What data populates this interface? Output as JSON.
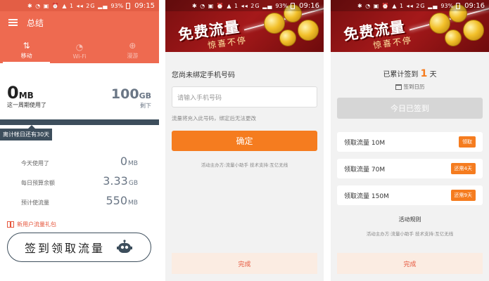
{
  "status": {
    "time": "09:15",
    "time2": "09:16",
    "battery": "93%",
    "icons": "✱ ◔ ▣ ⏰ ▲ 1 ◂◂ 2G ▂▄"
  },
  "screen1": {
    "title": "总结",
    "tabs": [
      {
        "label": "移动",
        "icon": "⇅"
      },
      {
        "label": "Wi-Fi",
        "icon": "◔"
      },
      {
        "label": "漫游",
        "icon": "⊕"
      }
    ],
    "used": {
      "value": "0",
      "unit": "MB",
      "label": "这一周期使用了"
    },
    "remaining": {
      "value": "100",
      "unit": "GB",
      "label": "剩下"
    },
    "progress_used_fraction": 0.0,
    "cycle_tip": "离计帐日还有30天",
    "stats": [
      {
        "label": "今天使用了",
        "value": "0",
        "unit": "MB"
      },
      {
        "label": "每日预算余额",
        "value": "3.33",
        "unit": "GB"
      },
      {
        "label": "预计使流量",
        "value": "550",
        "unit": "MB"
      }
    ],
    "gift_label": "新用户流量礼包",
    "checkin_label": "签到领取流量"
  },
  "banner": {
    "title": "免费流量",
    "subtitle": "惊喜不停"
  },
  "screen2": {
    "heading": "您尚未绑定手机号码",
    "phone_placeholder": "请输入手机号码",
    "hint": "流量将充入此号码，绑定后无法更改",
    "confirm_label": "确定",
    "credits": "活动主办方:流量小助手   技术支持:互亿无线",
    "done_label": "完成"
  },
  "screen3": {
    "signed_prefix": "已累计签到",
    "signed_days": "1",
    "signed_suffix": "天",
    "calendar_label": "签到日历",
    "signed_today_label": "今日已签到",
    "rewards": [
      {
        "label": "领取流量 10M",
        "action": "领取"
      },
      {
        "label": "领取流量 70M",
        "action": "还需4天"
      },
      {
        "label": "领取流量 150M",
        "action": "还需9天"
      }
    ],
    "rules_label": "活动规则",
    "credits": "活动主办方:流量小助手   技术支持:互亿无线",
    "done_label": "完成"
  },
  "colors": {
    "accent": "#ee6a50",
    "orange": "#f57c1f",
    "slate": "#3d4e5c"
  }
}
